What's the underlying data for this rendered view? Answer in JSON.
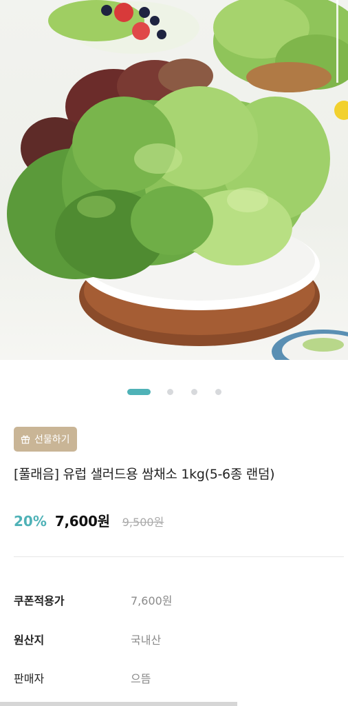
{
  "hero": {
    "image_alt": "",
    "carousel": {
      "total": 4,
      "active_index": 0
    }
  },
  "gift_button": {
    "icon": "gift-icon",
    "label": "선물하기"
  },
  "product": {
    "title": "[풀래음] 유럽 샐러드용 쌈채소 1kg(5-6종 랜덤)",
    "discount": "20%",
    "price": "7,600원",
    "original_price": "9,500원"
  },
  "info": [
    {
      "label": "쿠폰적용가",
      "value": "7,600원"
    },
    {
      "label": "원산지",
      "value": "국내산"
    },
    {
      "label": "판매자",
      "value": "으뜸"
    }
  ],
  "colors": {
    "accent": "#4fb2b7",
    "gift_badge": "#c9b596"
  }
}
